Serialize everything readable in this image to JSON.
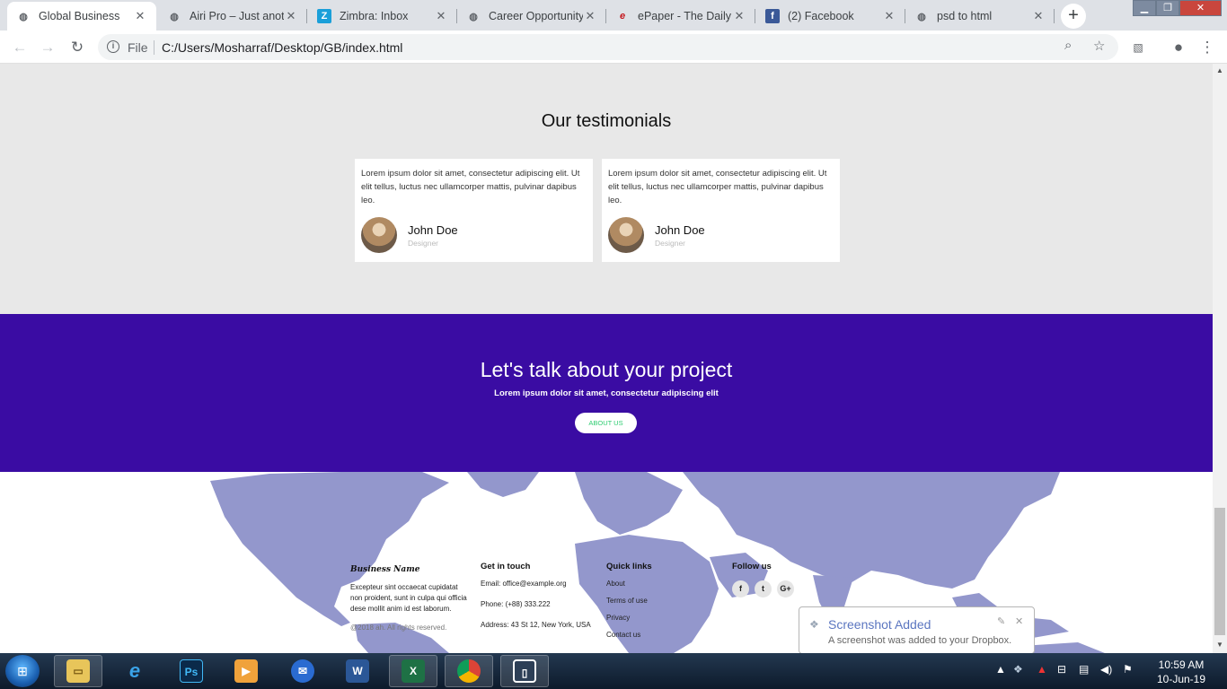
{
  "browser": {
    "tabs": [
      {
        "title": "Global Business",
        "favicon": "globe-icon",
        "active": true
      },
      {
        "title": "Airi Pro – Just anoth",
        "favicon": "globe-icon"
      },
      {
        "title": "Zimbra: Inbox",
        "favicon": "zimbra-icon"
      },
      {
        "title": "Career Opportunity",
        "favicon": "globe-icon"
      },
      {
        "title": "ePaper - The Daily",
        "favicon": "epaper-icon"
      },
      {
        "title": "(2) Facebook",
        "favicon": "facebook-icon"
      },
      {
        "title": "psd to html",
        "favicon": "globe-icon"
      }
    ],
    "omnibox": {
      "scheme_label": "File",
      "url": "C:/Users/Mosharraf/Desktop/GB/index.html"
    }
  },
  "testimonials": {
    "heading": "Our testimonials",
    "cards": [
      {
        "quote": "Lorem ipsum dolor sit amet, consectetur adipiscing elit. Ut elit tellus, luctus nec ullamcorper mattis, pulvinar dapibus leo.",
        "name": "John Doe",
        "role": "Designer"
      },
      {
        "quote": "Lorem ipsum dolor sit amet, consectetur adipiscing elit. Ut elit tellus, luctus nec ullamcorper mattis, pulvinar dapibus leo.",
        "name": "John Doe",
        "role": "Designer"
      }
    ]
  },
  "cta": {
    "heading": "Let's talk about your project",
    "subtext": "Lorem ipsum dolor sit amet, consectetur adipiscing elit",
    "button": "ABOUT US"
  },
  "footer": {
    "brand": "Business Name",
    "about": "Excepteur sint occaecat cupidatat non proident, sunt in culpa qui officia dese mollit anim id est laborum.",
    "copyright": "@2018 ah. All rights reserved.",
    "contact": {
      "heading": "Get in touch",
      "email": "Email: office@example.org",
      "phone": "Phone: (+88) 333.222",
      "address": "Address: 43 St 12, New York, USA"
    },
    "links": {
      "heading": "Quick links",
      "items": [
        "About",
        "Terms of use",
        "Privacy",
        "Contact us"
      ]
    },
    "follow": {
      "heading": "Follow us",
      "icons": [
        "f",
        "t",
        "G+"
      ]
    }
  },
  "toast": {
    "title": "Screenshot Added",
    "message": "A screenshot was added to your Dropbox."
  },
  "clock": {
    "time": "10:59 AM",
    "date": "10-Jun-19"
  },
  "colors": {
    "cta_bg": "#3a0ca3",
    "testimonial_bg": "#e8e8e8",
    "map": "#9397cc",
    "button_text": "#2ecc71"
  }
}
